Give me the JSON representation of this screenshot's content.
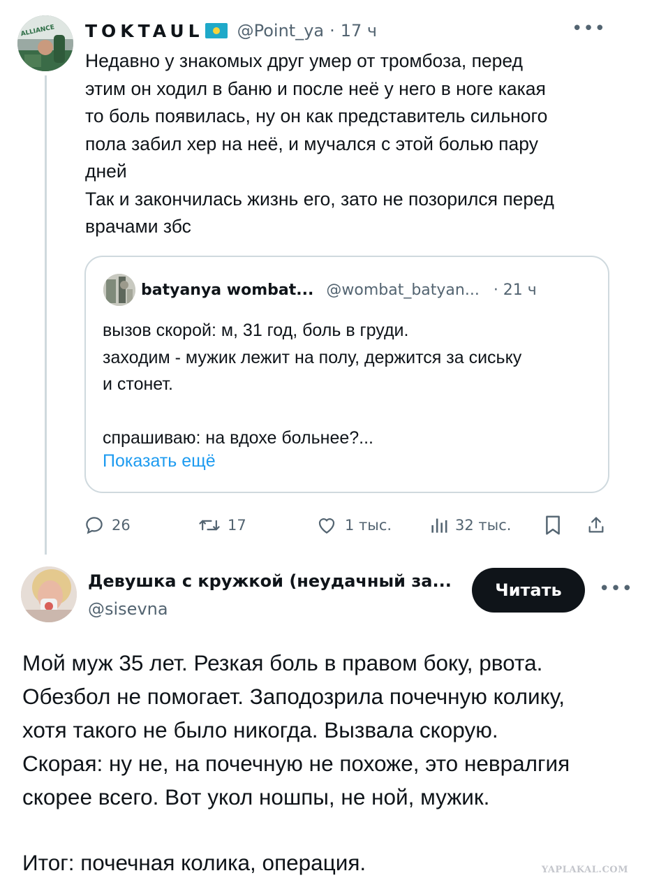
{
  "tweet": {
    "author_name": "TOKTAUL",
    "handle": "@Point_ya",
    "separator": "·",
    "time": "17 ч",
    "avatar_text": "ALLIANCE",
    "more_icon": "more-horizontal-icon",
    "text": [
      "Недавно у знакомых друг умер от тромбоза, перед",
      "этим он ходил в баню и после неё у него в ноге какая",
      "то боль появилась, ну он как представитель сильного",
      "пола забил хер на неё, и мучался с этой болью пару",
      "дней",
      "Так и закончилась жизнь его, зато не позорился перед",
      "врачами збс"
    ],
    "quote": {
      "author_name": "batyanya wombat...",
      "handle": "@wombat_batyan...",
      "time": "· 21 ч",
      "text": [
        "вызов скорой: м, 31 год, боль в груди.",
        "заходим - мужик лежит на полу, держится за сиську",
        "и стонет.",
        "",
        "спрашиваю: на вдохе больнее?..."
      ],
      "show_more": "Показать ещё"
    },
    "actions": {
      "replies": "26",
      "reposts": "17",
      "likes": "1 тыс.",
      "views": "32 тыс."
    }
  },
  "post2": {
    "author_name": "Девушка с кружкой (неудачный за...",
    "handle": "@sisevna",
    "read_button": "Читать",
    "text": [
      "Мой муж 35 лет. Резкая боль в правом боку, рвота.",
      "Обезбол не помогает. Заподозрила почечную колику,",
      "хотя такого не было никогда. Вызвала скорую.",
      "Скорая: ну не, на почечную не похоже, это невралгия",
      "скорее всего. Вот укол ношпы, не ной, мужик."
    ],
    "result": "Итог: почечная колика, операция."
  },
  "watermark": "YAPLAKAL.COM",
  "colors": {
    "text": "#0f1419",
    "secondary": "#536471",
    "link": "#1d9bf0",
    "border": "#cfd9de",
    "button": "#0f1419"
  }
}
